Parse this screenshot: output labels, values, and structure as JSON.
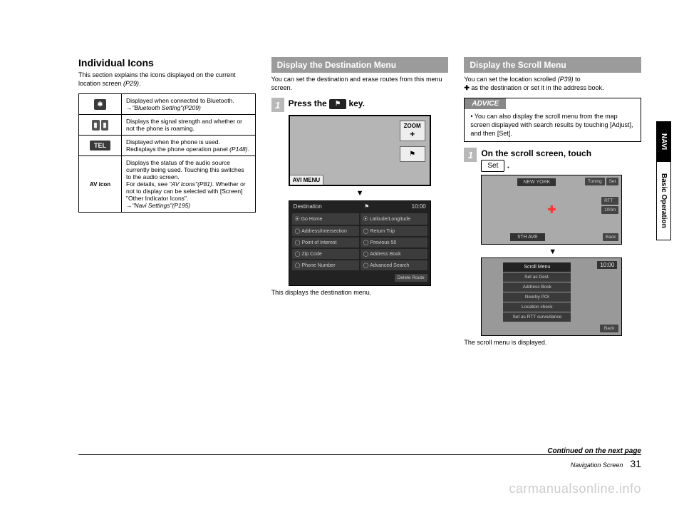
{
  "col1": {
    "title": "Individual Icons",
    "intro_a": "This section explains the icons displayed on the current location screen ",
    "intro_ref": "(P29)",
    "intro_b": ".",
    "rows": [
      {
        "icon_type": "bt",
        "icon_text": "✱",
        "desc_a": "Displayed when connected to Bluetooth.",
        "desc_link": "→",
        "desc_quote": "\"Bluetooth Setting\"(P209)"
      },
      {
        "icon_type": "sig",
        "icon_text": "▮",
        "desc_a": "Displays the signal strength and whether or not the phone is roaming."
      },
      {
        "icon_type": "tel",
        "icon_text": "TEL",
        "desc_a": "Displayed when the phone is used.",
        "desc_b": "Redisplays the phone operation panel ",
        "desc_ref": "(P148)",
        "desc_c": "."
      },
      {
        "icon_type": "text",
        "icon_text": "AV icon",
        "desc_a": "Displays the status of the audio source currently being used. Touching this switches to the audio screen.",
        "desc_b": "For details, see ",
        "desc_quote": "\"AV Icons\"(P81)",
        "desc_c": ". Whether or not to display can be selected with [Screen] \"Other Indicator Icons\".",
        "desc_link": "→",
        "desc_quote2": "\"Navi Settings\"(P195)"
      }
    ]
  },
  "col2": {
    "bar": "Display the Destination Menu",
    "intro": "You can set the destination and erase routes from this menu screen.",
    "step1_num": "1",
    "step1_a": "Press the ",
    "step1_key": "⚑",
    "step1_b": " key.",
    "ss1": {
      "zoom": "ZOOM",
      "plus": "+",
      "flag": "⚑",
      "menu": "AVI MENU"
    },
    "arrow": "▼",
    "ss2": {
      "title": "Destination",
      "icon": "⚑",
      "time": "10:00",
      "items": [
        "⦿ Go Home",
        "⦿ Latitude/Longitude",
        "◯ Address/Intersection",
        "◯ Return Trip",
        "◯ Point of Interest",
        "◯ Previous 50",
        "◯ Zip Code",
        "◯ Address Book",
        "◯ Phone Number",
        "◯ Advanced Search"
      ],
      "delete": "Delete Route"
    },
    "caption": "This displays the destination menu."
  },
  "col3": {
    "bar": "Display the Scroll Menu",
    "intro_a": "You can set the location scrolled ",
    "intro_ref": "(P39)",
    "intro_b": " to ",
    "intro_cross": "✚",
    "intro_c": " as the destination or set it in the address book.",
    "advice_head": "ADVICE",
    "advice_item": "You can also display the scroll menu from the map screen displayed with search results by touching [Adjust], and then [Set].",
    "step1_num": "1",
    "step1_a": "On the scroll screen, touch ",
    "step1_btn": "Set",
    "step1_b": " .",
    "ss3": {
      "top": "NEW YORK",
      "btns": [
        "Tuning",
        "Set"
      ],
      "side": [
        "RTT",
        "100m"
      ],
      "bottom": "5TH AVE",
      "back": "Back",
      "cross": "✚"
    },
    "arrow": "▼",
    "ss4": {
      "time": "10:00",
      "menu_head": "Scroll Menu",
      "items": [
        "Set as Dest.",
        "Address Book",
        "Nearby POI",
        "Location check",
        "Set as RTT surveillance"
      ],
      "back": "Back"
    },
    "caption": "The scroll menu is displayed."
  },
  "footer": {
    "cont": "Continued on the next page",
    "section": "Navigation Screen",
    "page": "31"
  },
  "tabs": {
    "navi": "NAVI",
    "basic": "Basic Operation"
  },
  "watermark": "carmanualsonline.info"
}
